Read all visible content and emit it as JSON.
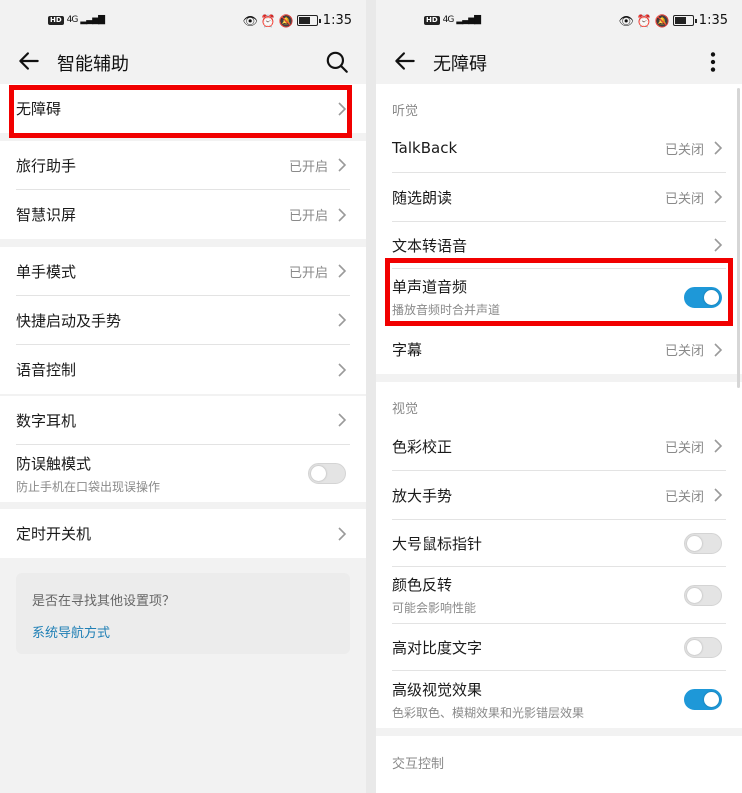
{
  "status_bar": {
    "network_badge": "HD",
    "signal": "4G",
    "time": "1:35"
  },
  "left": {
    "title": "智能辅助",
    "groups": [
      [
        {
          "label": "无障碍"
        }
      ],
      [
        {
          "label": "旅行助手",
          "status": "已开启"
        },
        {
          "label": "智慧识屏",
          "status": "已开启"
        }
      ],
      [
        {
          "label": "单手模式",
          "status": "已开启"
        },
        {
          "label": "快捷启动及手势"
        },
        {
          "label": "语音控制"
        }
      ],
      [
        {
          "label": "数字耳机"
        },
        {
          "label": "防误触模式",
          "sub": "防止手机在口袋出现误操作",
          "toggle": false
        }
      ],
      [
        {
          "label": "定时开关机"
        }
      ]
    ],
    "hint": {
      "question": "是否在寻找其他设置项？",
      "link": "系统导航方式"
    }
  },
  "right": {
    "title": "无障碍",
    "sections": [
      {
        "header": "听觉",
        "items": [
          {
            "label": "TalkBack",
            "status": "已关闭"
          },
          {
            "label": "随选朗读",
            "status": "已关闭"
          },
          {
            "label": "文本转语音"
          },
          {
            "label": "单声道音频",
            "sub": "播放音频时合并声道",
            "toggle": true
          },
          {
            "label": "字幕",
            "status": "已关闭"
          }
        ]
      },
      {
        "header": "视觉",
        "items": [
          {
            "label": "色彩校正",
            "status": "已关闭"
          },
          {
            "label": "放大手势",
            "status": "已关闭"
          },
          {
            "label": "大号鼠标指针",
            "toggle": false
          },
          {
            "label": "颜色反转",
            "sub": "可能会影响性能",
            "toggle": false
          },
          {
            "label": "高对比度文字",
            "toggle": false
          },
          {
            "label": "高级视觉效果",
            "sub": "色彩取色、模糊效果和光影错层效果",
            "toggle": true
          }
        ]
      },
      {
        "header": "交互控制",
        "items": []
      }
    ]
  },
  "colors": {
    "highlight": "#f10000",
    "toggle_on": "#1e98d8",
    "link": "#1f7fb5"
  },
  "icons": {
    "back": "arrow-left-icon",
    "search": "search-icon",
    "more": "more-vertical-icon",
    "chevron": "chevron-right-icon",
    "eye": "eye-icon",
    "alarm": "alarm-icon",
    "mute": "bell-off-icon",
    "battery": "battery-icon"
  }
}
